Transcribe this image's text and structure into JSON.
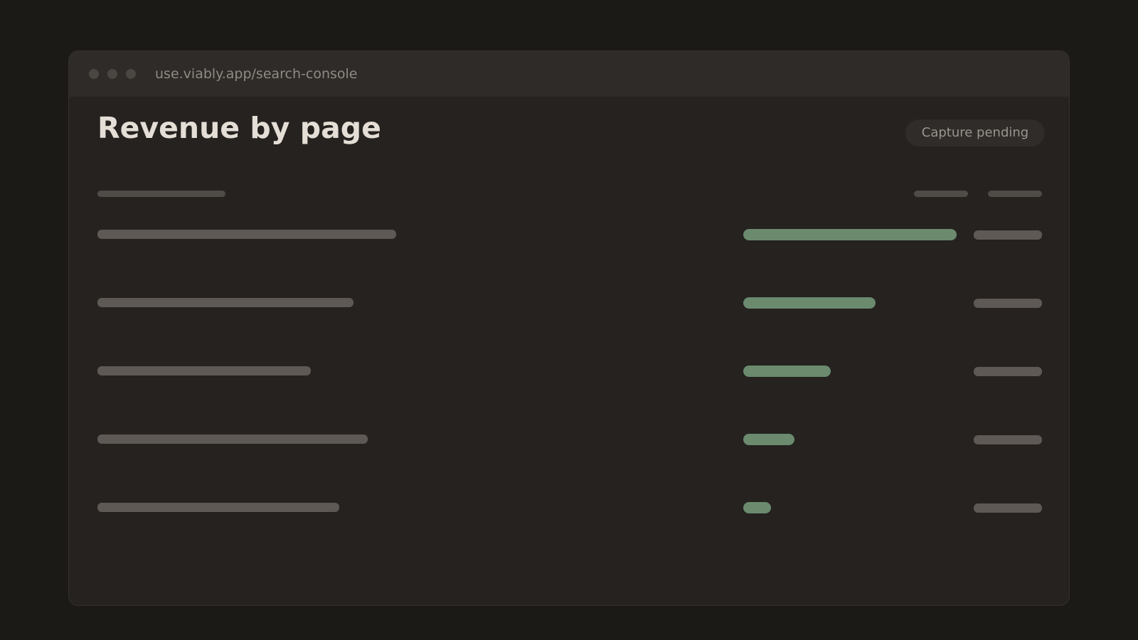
{
  "window": {
    "url": "use.viably.app/search-console"
  },
  "page": {
    "title": "Revenue by page",
    "status": "Capture pending"
  },
  "table": {
    "loading": true,
    "rows": [
      {
        "revenue_share": 1.0
      },
      {
        "revenue_share": 0.62
      },
      {
        "revenue_share": 0.41
      },
      {
        "revenue_share": 0.24
      },
      {
        "revenue_share": 0.13
      }
    ]
  },
  "colors": {
    "background": "#1c1a17",
    "window": "#252220",
    "titlebar": "#2e2b28",
    "skeleton": "#5e5955",
    "bar_accent": "#6b8a6e",
    "title_text": "#e4ded6"
  }
}
